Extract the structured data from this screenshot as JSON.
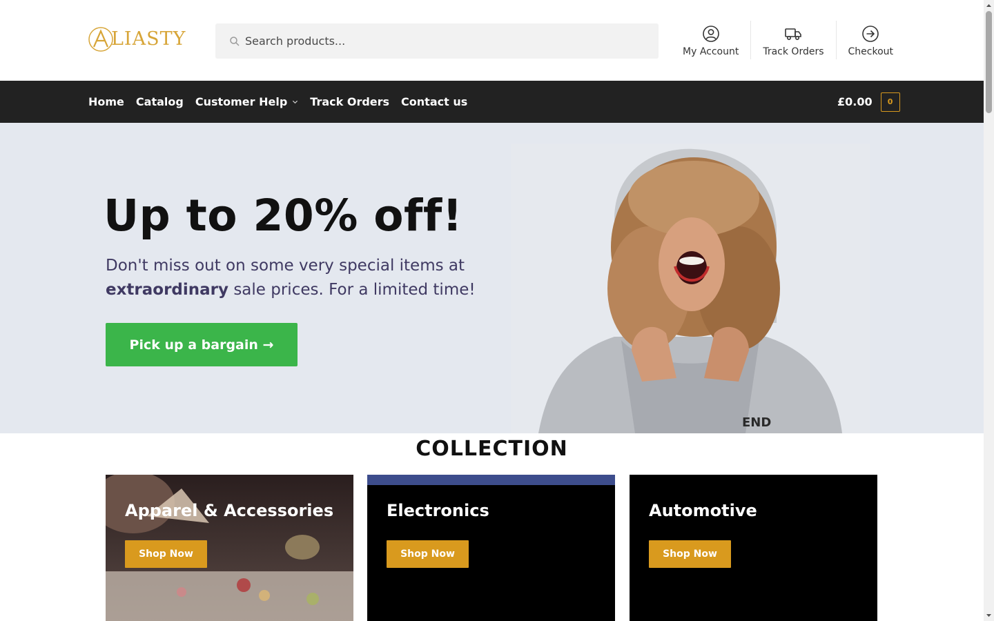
{
  "brand": {
    "logo_text": "LIASTY",
    "logo_letter": "A"
  },
  "search": {
    "placeholder": "Search products..."
  },
  "header_links": [
    {
      "label": "My Account",
      "icon": "user-circle-icon"
    },
    {
      "label": "Track Orders",
      "icon": "truck-icon"
    },
    {
      "label": "Checkout",
      "icon": "arrow-circle-right-icon"
    }
  ],
  "nav": {
    "items": [
      "Home",
      "Catalog",
      "Customer Help",
      "Track Orders",
      "Contact us"
    ]
  },
  "cart": {
    "total": "£0.00",
    "count": "0"
  },
  "hero": {
    "title": "Up to 20% off!",
    "text_before": "Don't miss out on some very special items at ",
    "text_bold": "extraordinary",
    "text_after": " sale prices. For a limited time!",
    "button": "Pick up a bargain →"
  },
  "collection": {
    "title": "COLLECTION",
    "cards": [
      {
        "title": "Apparel & Accessories",
        "button": "Shop Now"
      },
      {
        "title": "Electronics",
        "button": "Shop Now"
      },
      {
        "title": "Automotive",
        "button": "Shop Now"
      }
    ]
  },
  "colors": {
    "accent": "#d99a1e",
    "cta_green": "#3bb54a",
    "nav_bg": "#222222",
    "hero_bg": "#e4e8ef",
    "logo_gold": "#d7a538"
  }
}
